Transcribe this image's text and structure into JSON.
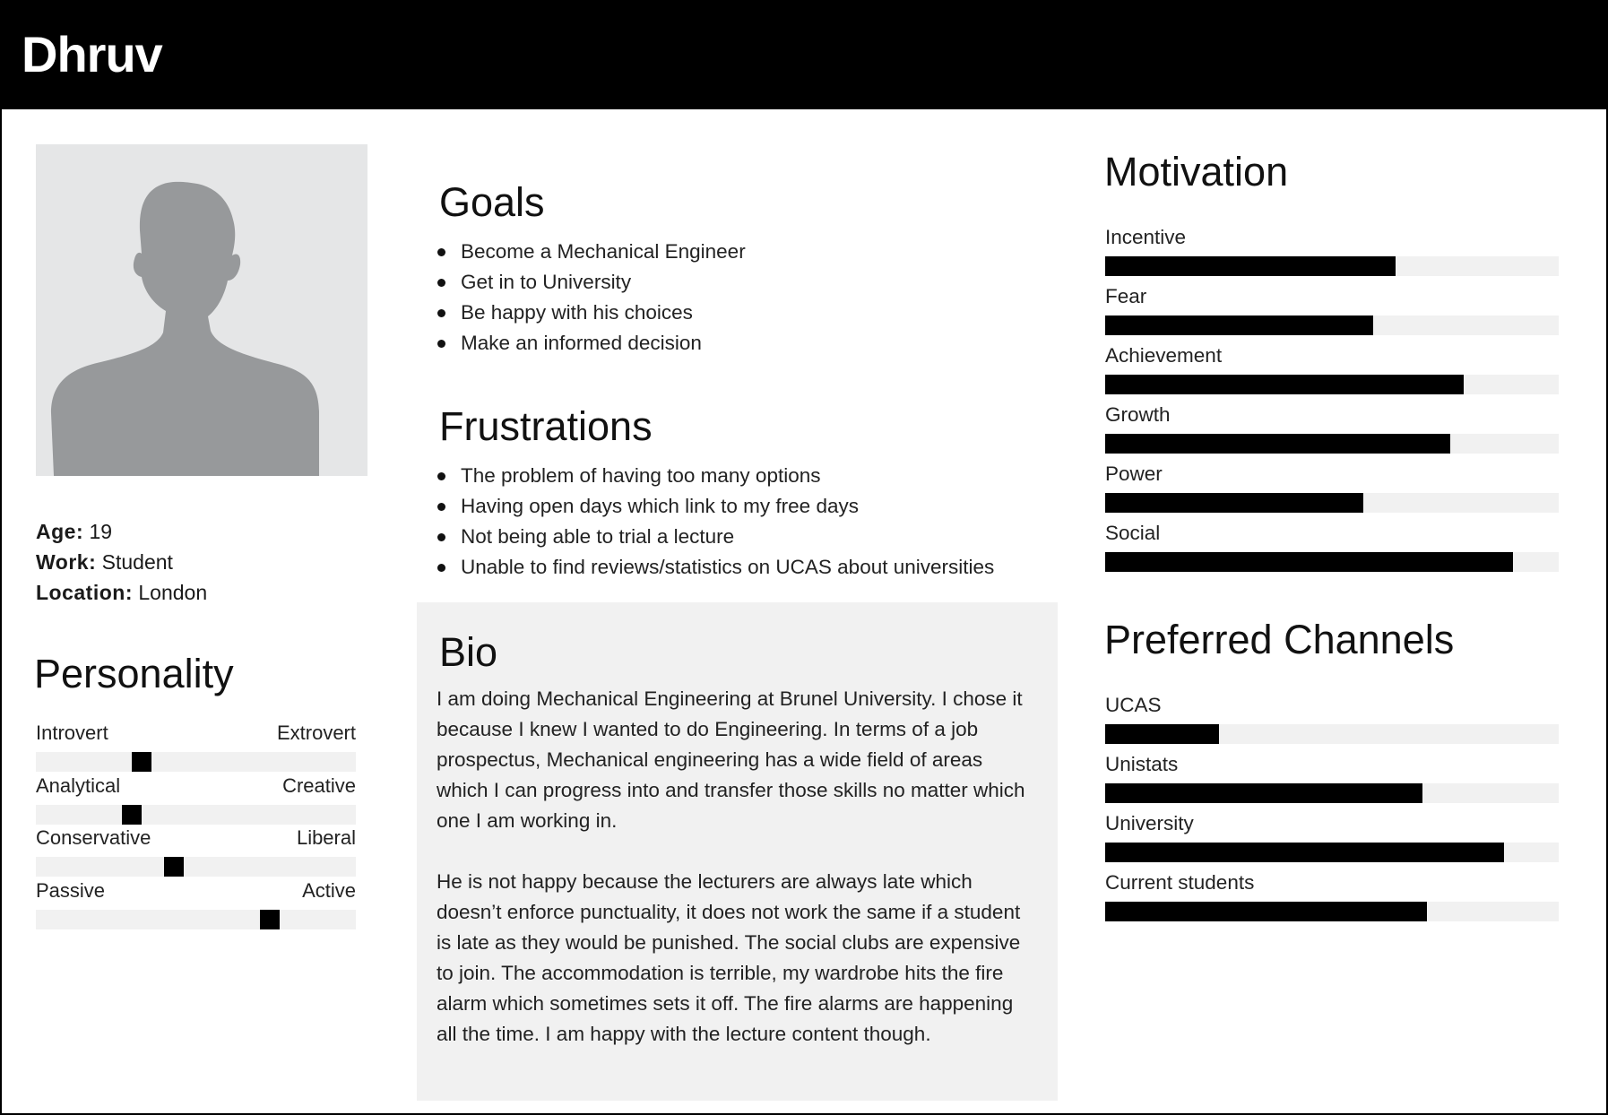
{
  "persona": {
    "name": "Dhruv",
    "avatar_icon": "user-silhouette-icon"
  },
  "facts": [
    {
      "key": "Age:",
      "value": "19"
    },
    {
      "key": "Work:",
      "value": "Student"
    },
    {
      "key": "Location:",
      "value": "London"
    }
  ],
  "personality": {
    "title": "Personality",
    "traits": [
      {
        "left": "Introvert",
        "right": "Extrovert",
        "value": 0.33
      },
      {
        "left": "Analytical",
        "right": "Creative",
        "value": 0.3
      },
      {
        "left": "Conservative",
        "right": "Liberal",
        "value": 0.43
      },
      {
        "left": "Passive",
        "right": "Active",
        "value": 0.73
      }
    ]
  },
  "goals": {
    "title": "Goals",
    "items": [
      "Become a Mechanical Engineer",
      "Get in to University",
      "Be happy with his choices",
      "Make an informed decision"
    ]
  },
  "frustrations": {
    "title": "Frustrations",
    "items": [
      "The problem of having too many options",
      "Having open days which link to my free days",
      "Not being able to trial a lecture",
      "Unable to find reviews/statistics on UCAS about universities"
    ]
  },
  "bio": {
    "title": "Bio",
    "paragraphs": [
      "I am doing Mechanical Engineering at Brunel University. I chose it because I knew I wanted to do Engineering. In terms of a job prospectus, Mechanical engineering has a wide field of areas which I can progress into and transfer those skills no matter which one I am working in.",
      "He is not happy because the lecturers are always late which doesn’t enforce punctuality, it does not work the same if a student is late as they would be punished. The social clubs are expensive to join. The accommodation is terrible, my wardrobe hits the fire alarm which sometimes sets it off. The fire alarms are happening all the time. I am happy with the lecture content though."
    ]
  },
  "motivation": {
    "title": "Motivation",
    "items": [
      {
        "label": "Incentive",
        "value": 0.64
      },
      {
        "label": "Fear",
        "value": 0.59
      },
      {
        "label": "Achievement",
        "value": 0.79
      },
      {
        "label": "Growth",
        "value": 0.76
      },
      {
        "label": "Power",
        "value": 0.57
      },
      {
        "label": "Social",
        "value": 0.9
      }
    ]
  },
  "channels": {
    "title": "Preferred Channels",
    "items": [
      {
        "label": "UCAS",
        "value": 0.25
      },
      {
        "label": "Unistats",
        "value": 0.7
      },
      {
        "label": "University",
        "value": 0.88
      },
      {
        "label": "Current students",
        "value": 0.71
      }
    ]
  },
  "colors": {
    "header_bg": "#000000",
    "bar_fill": "#000000",
    "track": "#f1f1f1",
    "avatar_bg": "#e5e6e7",
    "avatar_fg": "#97999b"
  }
}
